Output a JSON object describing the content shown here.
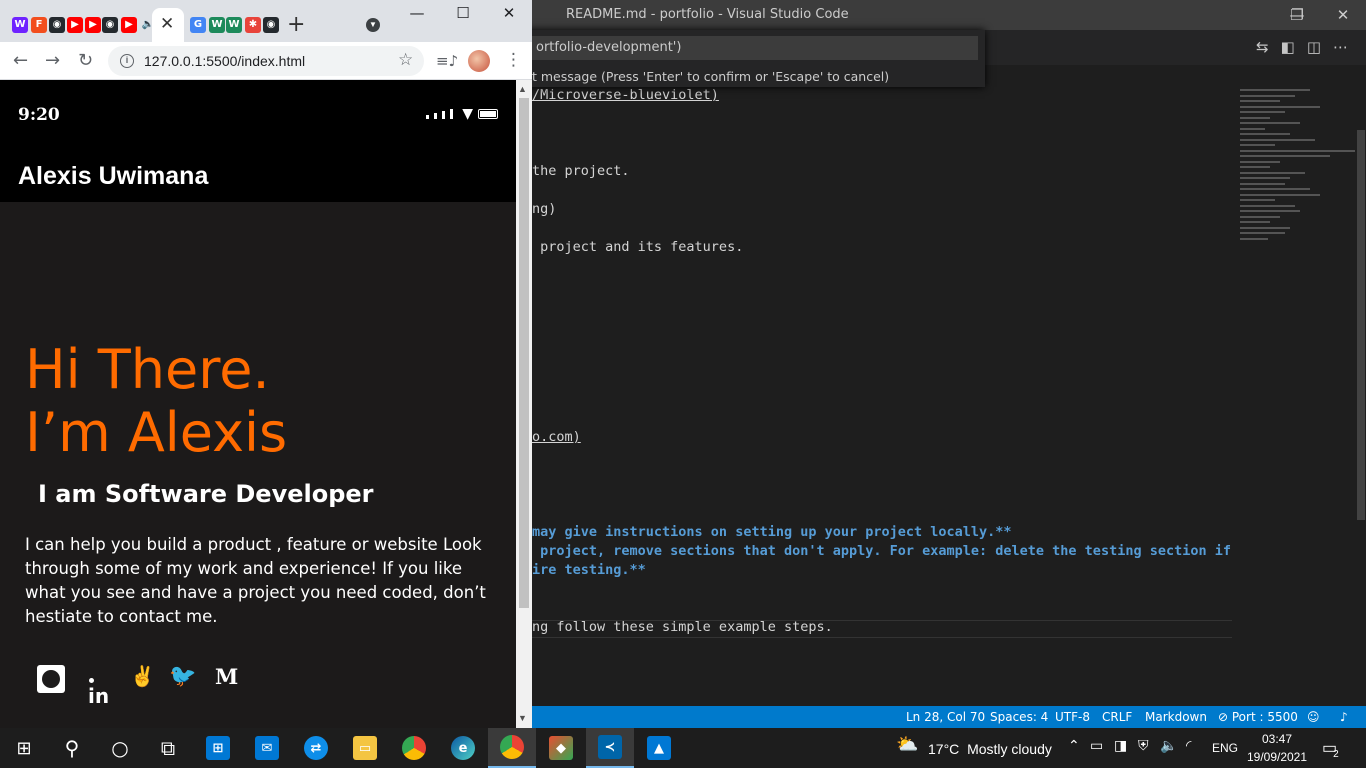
{
  "vscode": {
    "title": "README.md - portfolio - Visual Studio Code",
    "window_buttons": {
      "minimize": "—",
      "restore": "❐",
      "close": "✕"
    },
    "quick_input": {
      "value": "ortfolio-development')",
      "hint": "t message (Press 'Enter' to confirm or 'Escape' to cancel)"
    },
    "editor_lines": [
      {
        "text": "/Microverse-blueviolet)",
        "style": "link"
      },
      {
        "text": "the project.",
        "style": "normal"
      },
      {
        "text": "ng)",
        "style": "normal"
      },
      {
        "text": " project and its features.",
        "style": "normal"
      },
      {
        "text": "o.com)",
        "style": "link"
      },
      {
        "text": "may give instructions on setting up your project locally.**",
        "style": "bold"
      },
      {
        "text": " project, remove sections that don't apply. For example: delete the testing section if",
        "style": "bold"
      },
      {
        "text": "ire testing.**",
        "style": "bold"
      },
      {
        "text": "ng follow these simple example steps.",
        "style": "normal"
      }
    ],
    "statusbar": {
      "position": "Ln 28, Col 70",
      "spaces": "Spaces: 4",
      "encoding": "UTF-8",
      "eol": "CRLF",
      "language": "Markdown",
      "port": "Port : 5500"
    },
    "accent": "#007acc"
  },
  "chrome": {
    "url": "127.0.0.1:5500/index.html",
    "tabs": [
      {
        "icon": "microverse-icon",
        "glyph": "W",
        "color": "#6f23ff"
      },
      {
        "icon": "figma-icon",
        "glyph": "F",
        "color": "#f24e1e"
      },
      {
        "icon": "github-icon",
        "glyph": "◉",
        "color": "#24292e"
      },
      {
        "icon": "youtube-icon",
        "glyph": "▶",
        "color": "#ff0000"
      },
      {
        "icon": "youtube-icon",
        "glyph": "▶",
        "color": "#ff0000"
      },
      {
        "icon": "github-icon",
        "glyph": "◉",
        "color": "#24292e"
      },
      {
        "icon": "youtube-icon",
        "glyph": "▶",
        "color": "#ff0000"
      },
      {
        "icon": "speaker-icon",
        "glyph": "🔈",
        "color": "transparent"
      },
      {
        "icon": "google-icon",
        "glyph": "G",
        "color": "#4285f4"
      },
      {
        "icon": "medium-icon",
        "glyph": "W",
        "color": "#1d8a5b"
      },
      {
        "icon": "medium-icon",
        "glyph": "W",
        "color": "#1d8a5b"
      },
      {
        "icon": "asterisk-icon",
        "glyph": "✱",
        "color": "#e8433a"
      },
      {
        "icon": "github-icon",
        "glyph": "◉",
        "color": "#24292e"
      }
    ]
  },
  "page": {
    "status_time": "9:20",
    "brand": "Alexis Uwimana",
    "hero_line1": "Hi There.",
    "hero_line2": "I’m Alexis",
    "subtitle": "I am Software Developer",
    "description": "I can help you build a product , feature or website Look through some of my work and experience! If you like what you see and have a project you need coded, don’t hestiate to contact me.",
    "accent": "#ff6b00",
    "socials": [
      "github-icon",
      "linkedin-icon",
      "angellist-icon",
      "twitter-icon",
      "medium-icon"
    ]
  },
  "taskbar": {
    "weather_temp": "17°C",
    "weather_text": "Mostly cloudy",
    "language": "ENG",
    "time": "03:47",
    "date": "19/09/2021",
    "notification_count": "2"
  }
}
